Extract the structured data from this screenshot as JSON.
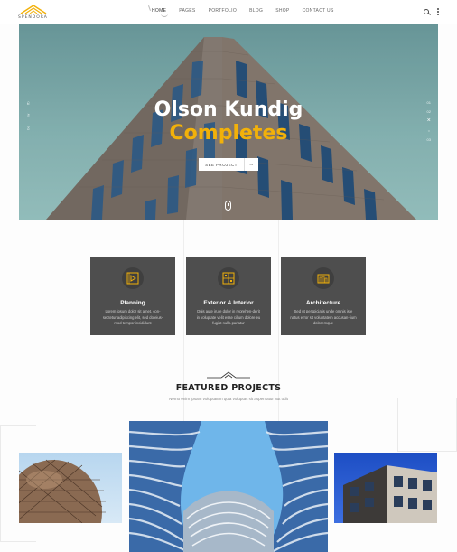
{
  "brand": {
    "name": "SPENDORA",
    "accent": "#f2b10a"
  },
  "nav": {
    "items": [
      {
        "label": "HOME",
        "active": true
      },
      {
        "label": "PAGES"
      },
      {
        "label": "PORTFOLIO"
      },
      {
        "label": "BLOG"
      },
      {
        "label": "SHOP"
      },
      {
        "label": "CONTACT US"
      }
    ]
  },
  "header_icons": [
    "search-icon",
    "more-vertical-icon"
  ],
  "hero": {
    "title_line1": "Olson Kundig",
    "title_line2": "Completes",
    "button_label": "SEE PROJECT",
    "button_arrow": "→",
    "social": [
      "fb",
      "tw",
      "be"
    ],
    "slider": [
      "01",
      "02",
      "×",
      "○",
      "03"
    ]
  },
  "services": [
    {
      "icon": "blueprint-play-icon",
      "title": "Planning",
      "desc": "Lorem ipsum dolor sit amet, con-sectetur adipiscing elit, sed do eius-mod tempor incididunt"
    },
    {
      "icon": "interior-plan-icon",
      "title": "Exterior & Interior",
      "desc": "Duis aute irure dolor in reprehen-derit in voluptate velit esse cillum dolore eu fugiat nulla pariatur"
    },
    {
      "icon": "architecture-icon",
      "title": "Architecture",
      "desc": "Sed ut perspiciatis unde omnis iste natus error sit voluptatem accusan-tium doloremque"
    }
  ],
  "featured": {
    "title": "FEATURED PROJECTS",
    "subtitle": "Nemo enim ipsam voluptatem quia voluptas sit aspernatur aut odit"
  }
}
